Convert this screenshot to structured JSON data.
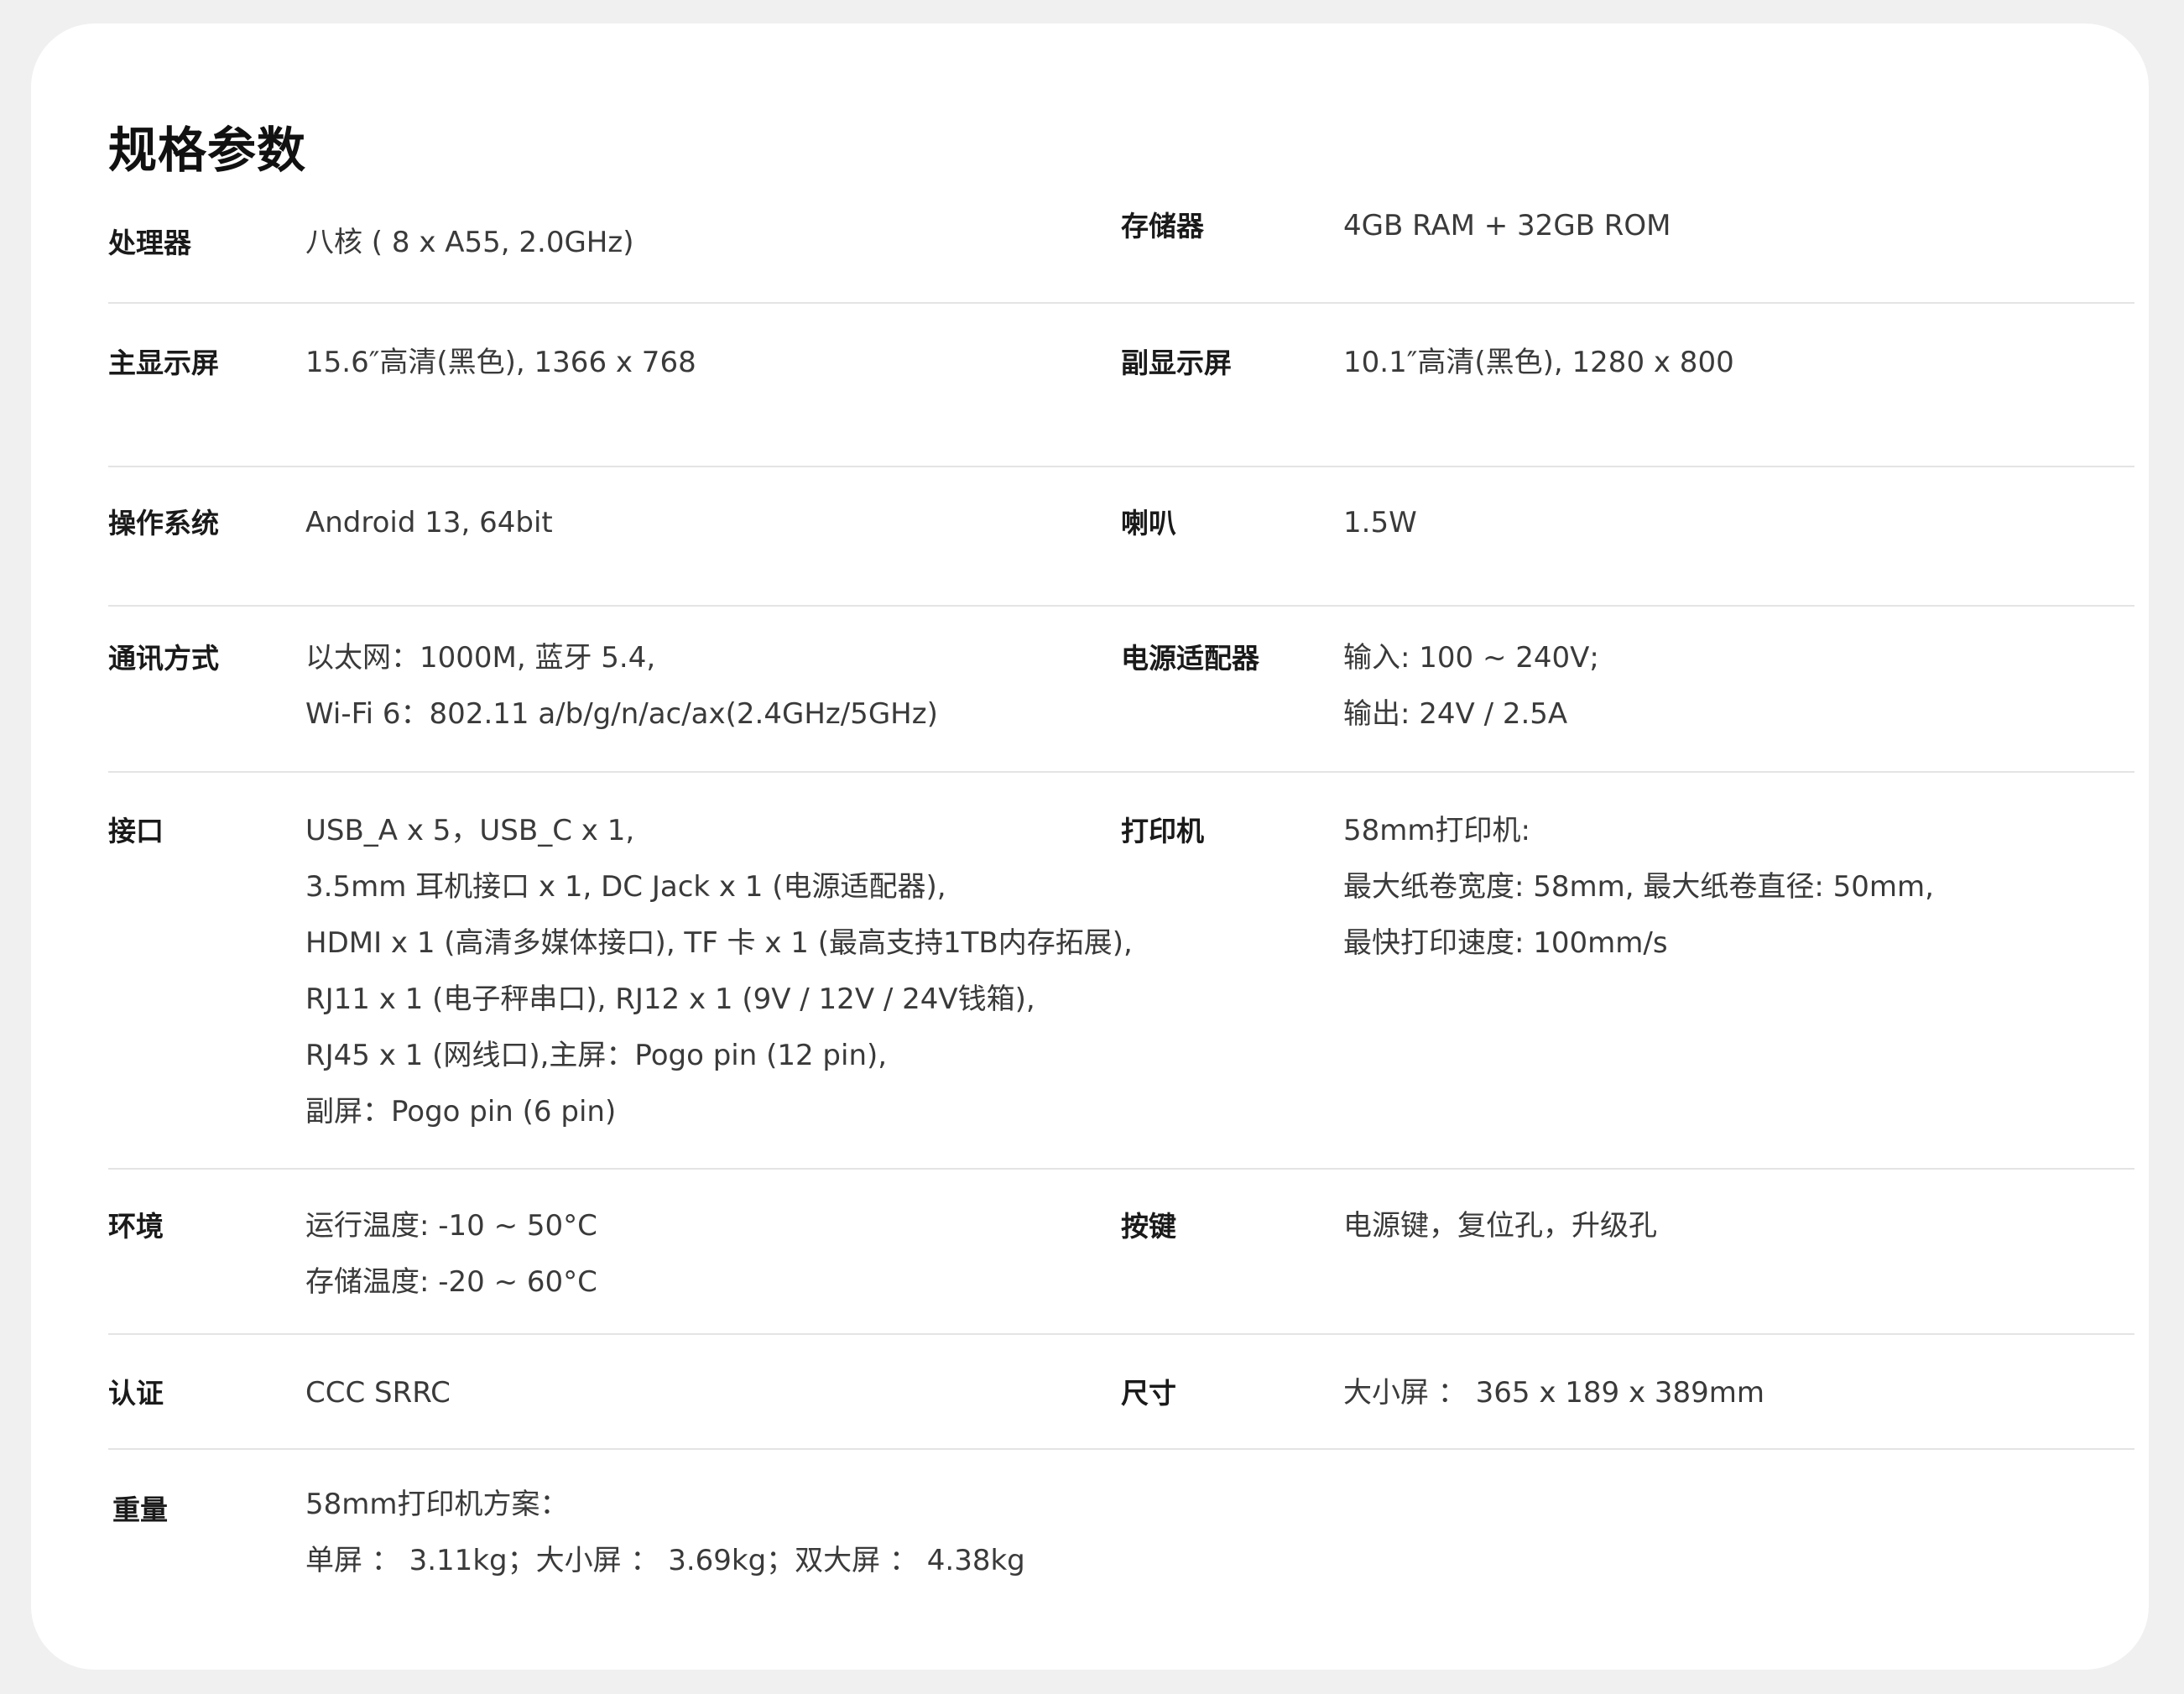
{
  "page": {
    "title": "规格参数"
  },
  "rows": [
    {
      "left": {
        "label": "处理器",
        "lines": [
          "八核 ( 8 x A55, 2.0GHz)"
        ]
      },
      "right": {
        "label": "存储器",
        "lines": [
          "4GB RAM + 32GB ROM"
        ]
      }
    },
    {
      "left": {
        "label": "主显示屏",
        "lines": [
          "15.6″高清(黑色), 1366 x 768"
        ]
      },
      "right": {
        "label": "副显示屏",
        "lines": [
          "10.1″高清(黑色), 1280 x 800"
        ]
      }
    },
    {
      "left": {
        "label": "操作系统",
        "lines": [
          "Android 13, 64bit"
        ]
      },
      "right": {
        "label": "喇叭",
        "lines": [
          "1.5W"
        ]
      }
    },
    {
      "left": {
        "label": "通讯方式",
        "lines": [
          "以太网：1000M, 蓝牙 5.4,",
          "Wi-Fi 6：802.11 a/b/g/n/ac/ax(2.4GHz/5GHz)"
        ]
      },
      "right": {
        "label": "电源适配器",
        "lines": [
          "输入: 100 ~ 240V;",
          "输出: 24V / 2.5A"
        ]
      }
    },
    {
      "left": {
        "label": "接口",
        "lines": [
          "USB_A x 5，USB_C x 1,",
          "3.5mm 耳机接口 x 1, DC Jack x 1 (电源适配器),",
          "HDMI x 1 (高清多媒体接口), TF 卡 x 1 (最高支持1TB内存拓展),",
          "RJ11 x 1 (电子秤串口), RJ12 x 1 (9V / 12V / 24V钱箱),",
          "RJ45 x 1 (网线口),主屏：Pogo pin (12 pin),",
          "副屏：Pogo pin (6 pin)"
        ]
      },
      "right": {
        "label": "打印机",
        "lines": [
          "58mm打印机:",
          "最大纸卷宽度: 58mm, 最大纸卷直径: 50mm,",
          "最快打印速度: 100mm/s"
        ]
      }
    },
    {
      "left": {
        "label": "环境",
        "lines": [
          "运行温度: -10 ~ 50°C",
          "存储温度: -20 ~ 60°C"
        ]
      },
      "right": {
        "label": "按键",
        "lines": [
          "电源键，复位孔，升级孔"
        ]
      }
    },
    {
      "left": {
        "label": "认证",
        "lines": [
          "CCC SRRC"
        ]
      },
      "right": {
        "label": "尺寸",
        "lines": [
          "大小屏 ： 365 x 189 x 389mm"
        ]
      }
    },
    {
      "left": {
        "label": "重量",
        "lines": [
          "58mm打印机方案：",
          "单屏 ： 3.11kg；大小屏 ： 3.69kg；双大屏 ： 4.38kg"
        ]
      },
      "right": null
    }
  ]
}
